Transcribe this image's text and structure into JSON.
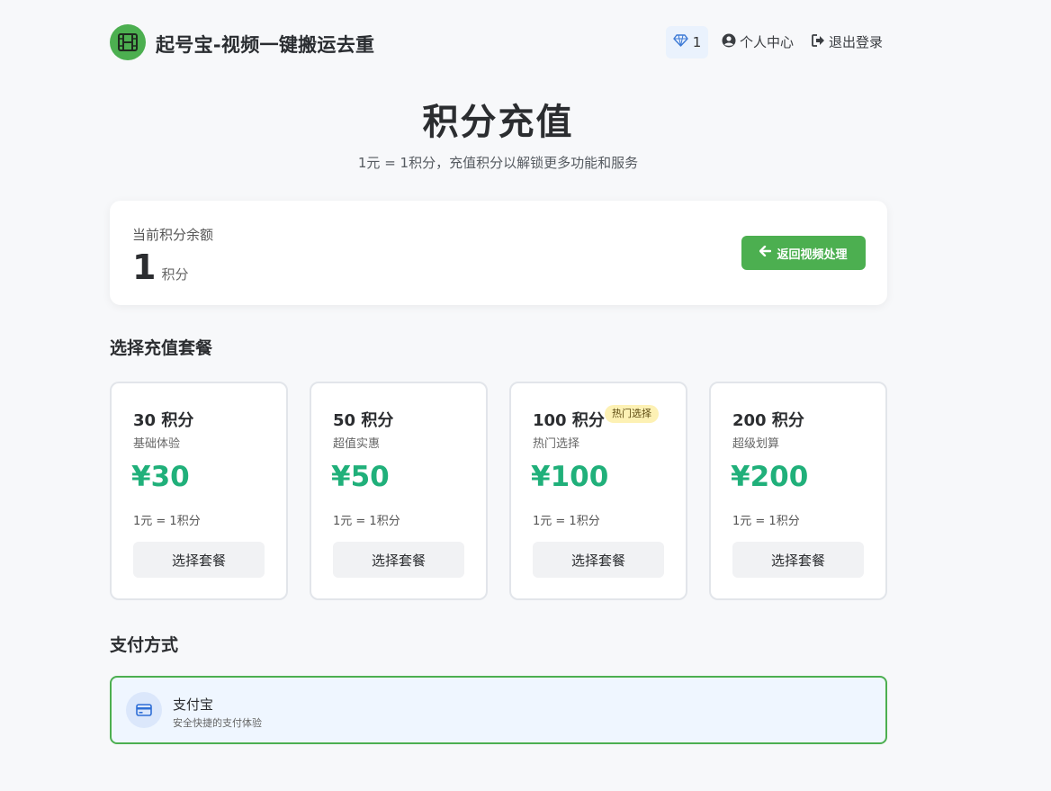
{
  "header": {
    "app_title": "起号宝-视频一键搬运去重",
    "points_count": "1",
    "profile_label": "个人中心",
    "logout_label": "退出登录"
  },
  "hero": {
    "title": "积分充值",
    "subtitle": "1元 = 1积分，充值积分以解锁更多功能和服务"
  },
  "balance": {
    "label": "当前积分余额",
    "value": "1",
    "unit": "积分",
    "back_button": "返回视频处理"
  },
  "packages_section": {
    "title": "选择充值套餐",
    "items": [
      {
        "name": "30 积分",
        "desc": "基础体验",
        "price": "¥30",
        "rate": "1元 = 1积分",
        "button": "选择套餐"
      },
      {
        "name": "50 积分",
        "desc": "超值实惠",
        "price": "¥50",
        "rate": "1元 = 1积分",
        "button": "选择套餐"
      },
      {
        "name": "100 积分",
        "tag": "热门选择",
        "desc": "热门选择",
        "price": "¥100",
        "rate": "1元 = 1积分",
        "button": "选择套餐"
      },
      {
        "name": "200 积分",
        "desc": "超级划算",
        "price": "¥200",
        "rate": "1元 = 1积分",
        "button": "选择套餐"
      }
    ]
  },
  "payment_section": {
    "title": "支付方式",
    "method_name": "支付宝",
    "method_desc": "安全快捷的支付体验"
  },
  "colors": {
    "brand_green": "#4caf50",
    "price_green": "#20b07a",
    "chip_blue": "#eaf2fd",
    "tag_yellow": "#fdf1b4"
  },
  "icons": {
    "logo": "film-icon",
    "points": "gem-icon",
    "profile": "user-circle-icon",
    "logout": "sign-out-icon",
    "back": "arrow-left-icon",
    "payment": "credit-card-icon"
  }
}
